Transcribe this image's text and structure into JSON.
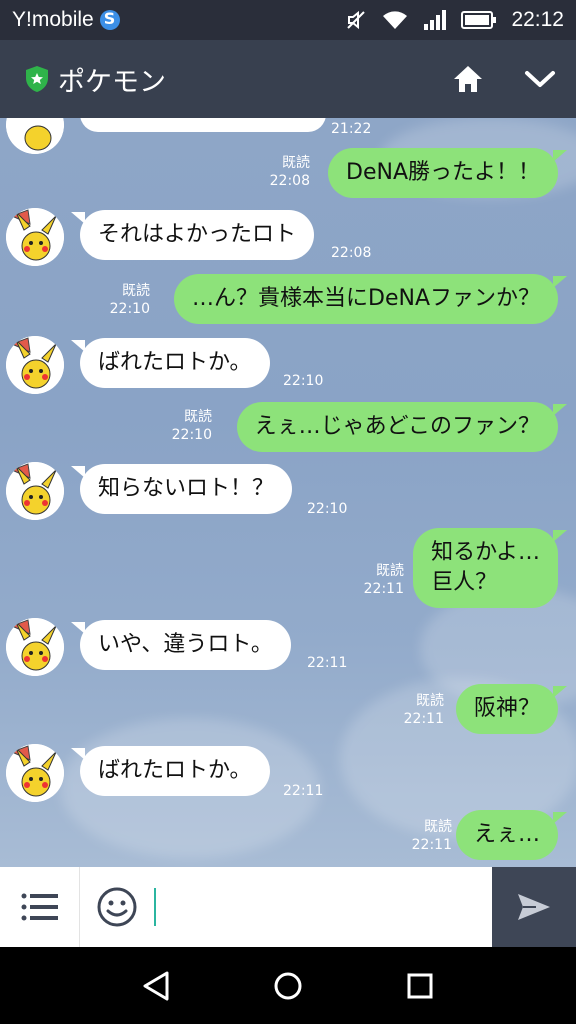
{
  "status_bar": {
    "carrier": "Y!mobile",
    "time": "22:12"
  },
  "header": {
    "title": "ポケモン"
  },
  "messages": [
    {
      "side": "in",
      "text": "",
      "time": "21:22"
    },
    {
      "side": "out",
      "read": "既読",
      "time": "22:08",
      "text": "DeNA勝ったよ！！"
    },
    {
      "side": "in",
      "text": "それはよかったロト",
      "time": "22:08"
    },
    {
      "side": "out",
      "read": "既読",
      "time": "22:10",
      "text": "…ん？貴様本当にDeNAファンか？"
    },
    {
      "side": "in",
      "text": "ばれたロトか。",
      "time": "22:10"
    },
    {
      "side": "out",
      "read": "既読",
      "time": "22:10",
      "text": "えぇ…じゃあどこのファン？"
    },
    {
      "side": "in",
      "text": "知らないロト！？",
      "time": "22:10"
    },
    {
      "side": "out",
      "read": "既読",
      "time": "22:11",
      "text_line1": "知るかよ…",
      "text_line2": "巨人？"
    },
    {
      "side": "in",
      "text": "いや、違うロト。",
      "time": "22:11"
    },
    {
      "side": "out",
      "read": "既読",
      "time": "22:11",
      "text": "阪神？"
    },
    {
      "side": "in",
      "text": "ばれたロトか。",
      "time": "22:11"
    },
    {
      "side": "out",
      "read": "既読",
      "time": "22:11",
      "text": "えぇ…"
    }
  ],
  "colors": {
    "header_bg": "#38404f",
    "outgoing_bubble": "#8de27a",
    "incoming_bubble": "#ffffff"
  }
}
